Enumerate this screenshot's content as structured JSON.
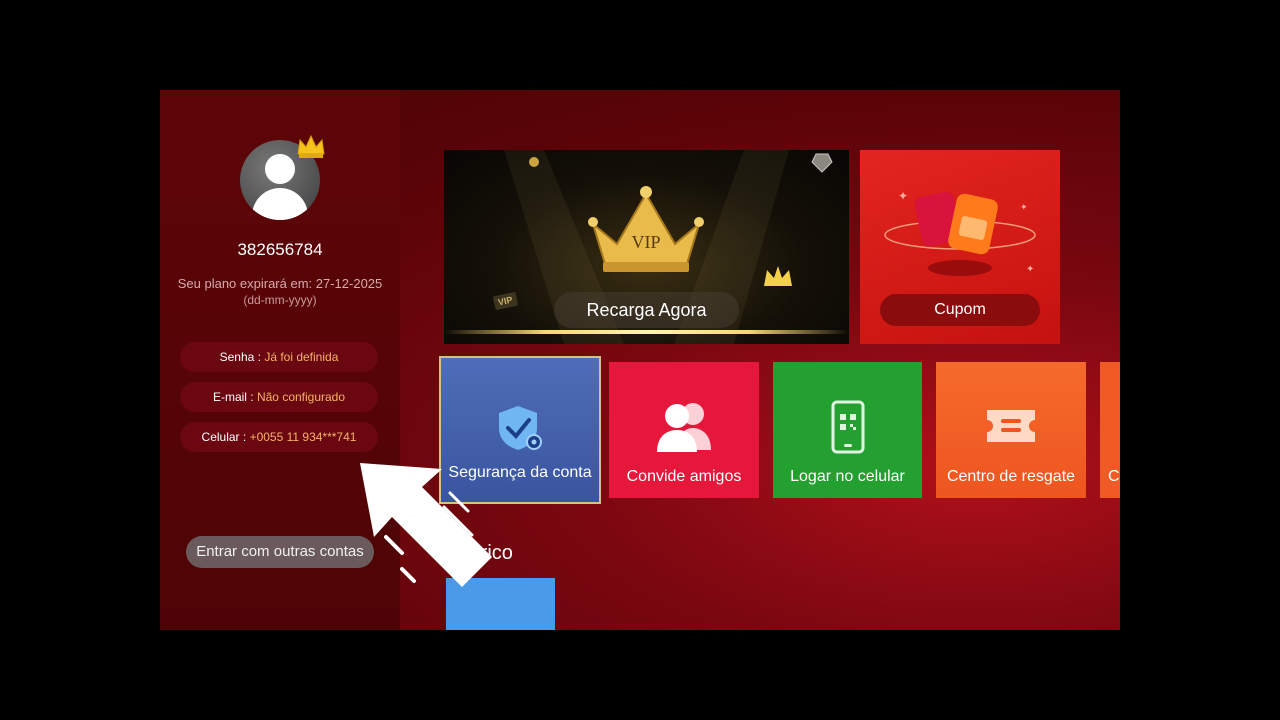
{
  "sidebar": {
    "user_id": "382656784",
    "plan_text": "Seu plano expirará em: 27-12-2025",
    "plan_format": "(dd-mm-yyyy)",
    "info": [
      {
        "label": "Senha : ",
        "value": "Já foi definida"
      },
      {
        "label": "E-mail : ",
        "value": "Não configurado"
      },
      {
        "label": "Celular : ",
        "value": "+0055 11 934***741"
      }
    ],
    "other_accounts_label": "Entrar com outras contas"
  },
  "banners": {
    "vip_text": "VIP",
    "vip_tag": "VIP",
    "recarga_label": "Recarga Agora",
    "cupom_label": "Cupom"
  },
  "tiles": [
    {
      "label": "Segurança da conta",
      "icon": "shield-gear-icon",
      "color": "#4f6db8"
    },
    {
      "label": "Convide amigos",
      "icon": "users-icon",
      "color": "#e5173b"
    },
    {
      "label": "Logar no celular",
      "icon": "phone-qr-icon",
      "color": "#24a030"
    },
    {
      "label": "Centro de resgate",
      "icon": "ticket-icon",
      "color": "#f56a2c"
    },
    {
      "label": "C",
      "icon": "",
      "color": "#f05a24"
    }
  ],
  "historico_label": "tórico",
  "colors": {
    "accent_value": "#f5b36a",
    "background": "#5a0408"
  }
}
